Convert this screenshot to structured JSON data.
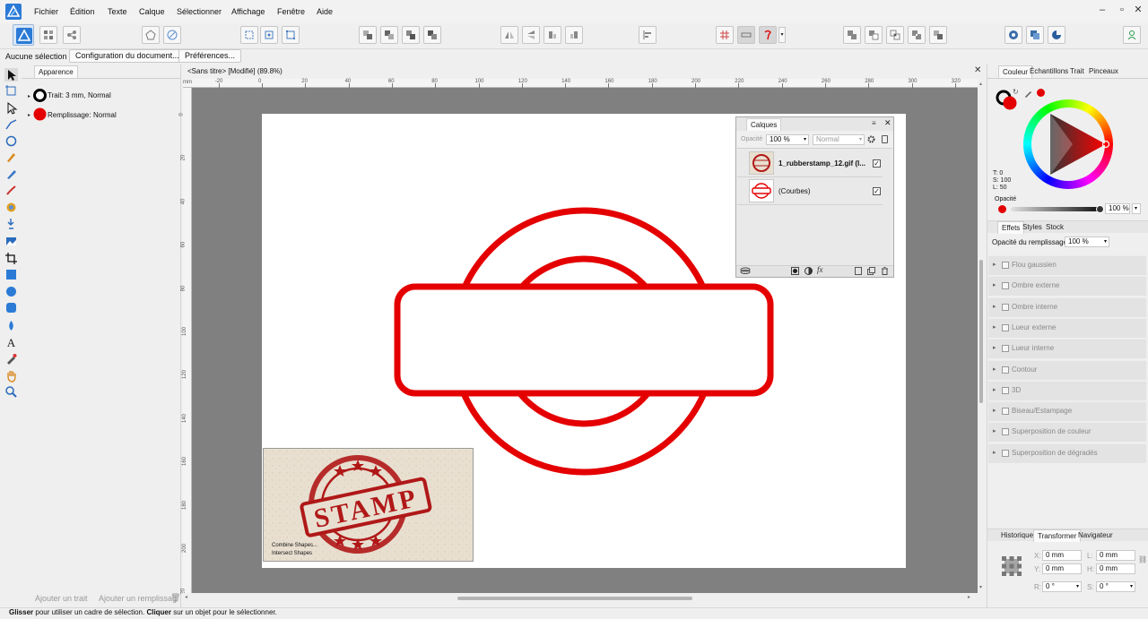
{
  "menu": [
    "Fichier",
    "Édition",
    "Texte",
    "Calque",
    "Sélectionner",
    "Affichage",
    "Fenêtre",
    "Aide"
  ],
  "window_controls": [
    "–",
    "▫",
    "✕"
  ],
  "context": {
    "selection": "Aucune sélection",
    "doc_setup": "Configuration du document...",
    "prefs": "Préférences..."
  },
  "left_panel": {
    "tab": "Apparence",
    "stroke_label": "Trait: 3 mm,",
    "stroke_mode": "Normal",
    "fill_label": "Remplissage:",
    "fill_mode": "Normal",
    "add_stroke": "Ajouter un trait",
    "add_fill": "Ajouter un remplissag"
  },
  "document": {
    "title": "<Sans titre> [Modifié] (89.8%)",
    "close": "✕"
  },
  "rulers": {
    "h": [
      "-20",
      "0",
      "20",
      "40",
      "60",
      "80",
      "100",
      "120",
      "140",
      "160",
      "180",
      "200",
      "220",
      "240",
      "260",
      "280",
      "300",
      "320"
    ],
    "v": [
      "0",
      "20",
      "40",
      "60",
      "80",
      "100",
      "120",
      "140",
      "160",
      "180",
      "200",
      "20"
    ]
  },
  "thumbnail": {
    "stamp_text": "STAMP",
    "caption1": "Combine Shapes...",
    "caption2": "Intersect Shapes"
  },
  "layers": {
    "title": "Calques",
    "opacity_label": "Opacité",
    "opacity_value": "100 %",
    "blend": "Normal",
    "items": [
      {
        "name": "1_rubberstamp_12.gif (I...",
        "checked": "✓"
      },
      {
        "name": "(Courbes)",
        "checked": "✓"
      }
    ]
  },
  "right_panel": {
    "tabs": [
      "Couleur",
      "Échantillons",
      "Trait",
      "Pinceaux"
    ],
    "hsl": {
      "t": "T: 0",
      "s": "S: 100",
      "l": "L: 50"
    },
    "opacity_label": "Opacité",
    "opacity_value": "100 %",
    "effects_tabs": [
      "Effets",
      "Styles",
      "Stock"
    ],
    "fill_opacity_label": "Opacité du remplissage:",
    "fill_opacity_value": "100 %",
    "effects": [
      "Flou gaussien",
      "Ombre externe",
      "Ombre interne",
      "Lueur externe",
      "Lueur interne",
      "Contour",
      "3D",
      "Biseau/Estampage",
      "Superposition de couleur",
      "Superposition de dégradés"
    ],
    "bottom_tabs": [
      "Historique",
      "Transformer",
      "Navigateur"
    ],
    "transform": {
      "x_label": "X:",
      "x": "0 mm",
      "y_label": "Y:",
      "y": "0 mm",
      "w_label": "L:",
      "w": "0 mm",
      "h_label": "H:",
      "h": "0 mm",
      "r_label": "R:",
      "r": "0 °",
      "s_label": "S:",
      "s": "0 °"
    }
  },
  "status": {
    "bold1": "Glisser",
    "text1": " pour utiliser un cadre de sélection. ",
    "bold2": "Cliquer",
    "text2": " sur un objet pour le sélectionner."
  },
  "colors": {
    "accent": "#e40000",
    "ui_bg": "#efefef",
    "canvas_bg": "#808080",
    "brand": "#2b7bd6"
  }
}
